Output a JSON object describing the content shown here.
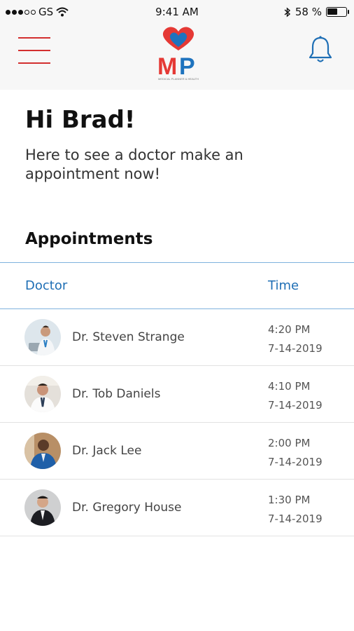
{
  "status": {
    "carrier": "GS",
    "time": "9:41 AM",
    "battery": "58 %",
    "battery_level": 0.58
  },
  "nav": {
    "menu_icon": "hamburger-menu-icon",
    "logo_text": "MP",
    "logo_tagline": "MEDICAL PLANNER & HEALTH",
    "bell_icon": "bell-icon"
  },
  "colors": {
    "accent_red": "#d32f2f",
    "accent_blue": "#1f6fb5",
    "divider_blue": "#7fb2de"
  },
  "greeting": "Hi Brad!",
  "subtitle": "Here to see a doctor make an appointment now!",
  "appointments": {
    "title": "Appointments",
    "columns": {
      "doctor": "Doctor",
      "time": "Time"
    },
    "rows": [
      {
        "doctor": "Dr. Steven Strange",
        "time": "4:20 PM",
        "date": "7-14-2019",
        "avatar": "doctor-laptop-avatar"
      },
      {
        "doctor": "Dr. Tob Daniels",
        "time": "4:10 PM",
        "date": "7-14-2019",
        "avatar": "doctor-white-coat-avatar"
      },
      {
        "doctor": "Dr. Jack Lee",
        "time": "2:00 PM",
        "date": "7-14-2019",
        "avatar": "doctor-blue-suit-avatar"
      },
      {
        "doctor": "Dr. Gregory House",
        "time": "1:30 PM",
        "date": "7-14-2019",
        "avatar": "doctor-black-suit-avatar"
      }
    ]
  }
}
